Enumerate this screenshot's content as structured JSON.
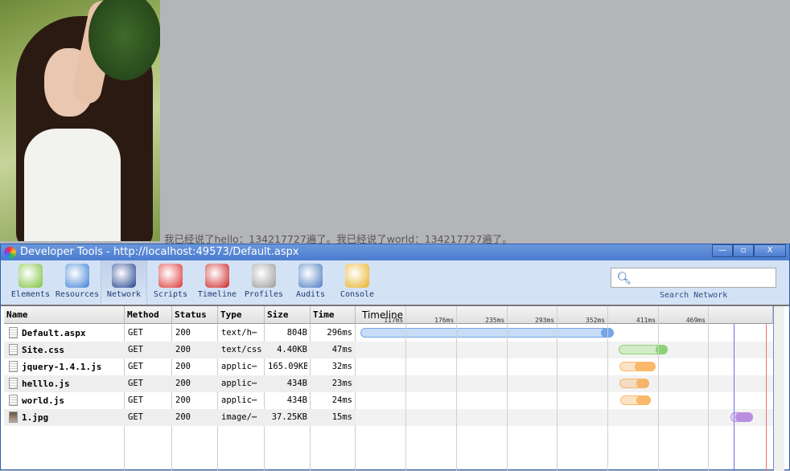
{
  "page": {
    "caption": "我已经说了hello：134217727遍了。我已经说了world：134217727遍了。"
  },
  "devtools": {
    "title": "Developer Tools - http://localhost:49573/Default.aspx",
    "window_buttons": [
      "—",
      "▫",
      "X"
    ],
    "tools": [
      {
        "label": "Elements",
        "color": "#7cc13a"
      },
      {
        "label": "Resources",
        "color": "#3b7fd6"
      },
      {
        "label": "Network",
        "color": "#1f3f8c",
        "active": true
      },
      {
        "label": "Scripts",
        "color": "#d33"
      },
      {
        "label": "Timeline",
        "color": "#c22"
      },
      {
        "label": "Profiles",
        "color": "#999"
      },
      {
        "label": "Audits",
        "color": "#4a7ac0"
      },
      {
        "label": "Console",
        "color": "#e8b020"
      }
    ],
    "search": {
      "placeholder": "",
      "label": "Search Network"
    },
    "columns": [
      "Name",
      "Method",
      "Status",
      "Type",
      "Size",
      "Time",
      "Timeline"
    ],
    "rows": [
      {
        "name": "Default.aspx",
        "method": "GET",
        "status": "200",
        "type": "text/h⋯",
        "size": "804B",
        "time": "296ms",
        "icon": "doc",
        "start": 64,
        "mid": 344,
        "end": 359,
        "color": "#c6dcf7",
        "dark": "#75a6e6"
      },
      {
        "name": "Site.css",
        "method": "GET",
        "status": "200",
        "type": "text/css",
        "size": "4.40KB",
        "time": "47ms",
        "icon": "doc",
        "start": 365,
        "mid": 408,
        "end": 422,
        "color": "#d3ecc8",
        "dark": "#8bd377"
      },
      {
        "name": "jquery-1.4.1.js",
        "method": "GET",
        "status": "200",
        "type": "applic⋯",
        "size": "165.09KB",
        "time": "32ms",
        "icon": "doc",
        "start": 366,
        "mid": 384,
        "end": 408,
        "color": "#fde3c6",
        "dark": "#f9b86a"
      },
      {
        "name": "helllo.js",
        "method": "GET",
        "status": "200",
        "type": "applic⋯",
        "size": "434B",
        "time": "23ms",
        "icon": "doc",
        "start": 366,
        "mid": 386,
        "end": 401,
        "color": "#f3dcc2",
        "dark": "#f5b46a"
      },
      {
        "name": "world.js",
        "method": "GET",
        "status": "200",
        "type": "applic⋯",
        "size": "434B",
        "time": "24ms",
        "icon": "doc",
        "start": 367,
        "mid": 386,
        "end": 403,
        "color": "#fde3c6",
        "dark": "#f9b86a"
      },
      {
        "name": "1.jpg",
        "method": "GET",
        "status": "200",
        "type": "image/⋯",
        "size": "37.25KB",
        "time": "15ms",
        "icon": "img",
        "start": 495,
        "mid": 501,
        "end": 522,
        "color": "#e8d8f3",
        "dark": "#b98ee0"
      }
    ],
    "timeline": {
      "ticks": [
        "117ms",
        "176ms",
        "235ms",
        "293ms",
        "352ms",
        "411ms",
        "469ms"
      ],
      "tick_values": [
        117,
        176,
        235,
        293,
        352,
        411,
        469
      ],
      "range_ms": [
        58.6,
        545
      ],
      "dom_content_loaded_ms": 499,
      "load_ms": 537,
      "dcl_color": "#6d6df0",
      "load_color": "#f07070"
    }
  }
}
